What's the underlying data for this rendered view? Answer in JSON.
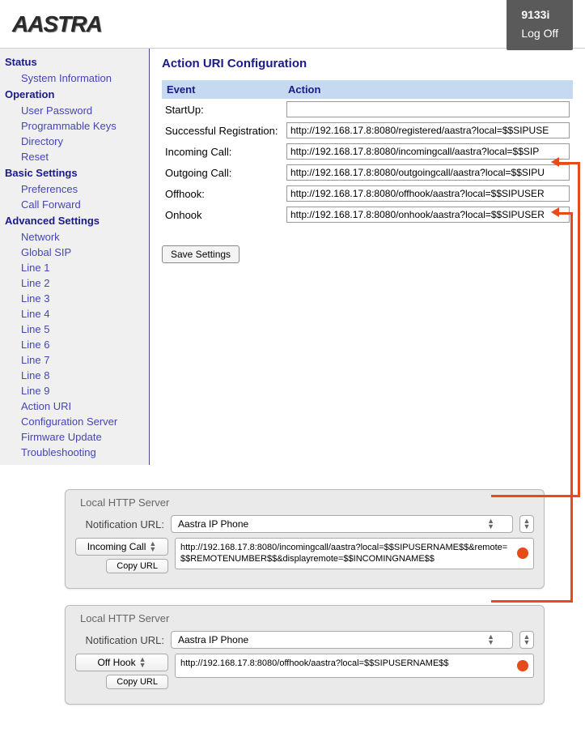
{
  "header": {
    "brand": "AASTRA",
    "model": "9133i",
    "logoff": "Log Off"
  },
  "sidebar": [
    {
      "type": "heading",
      "label": "Status"
    },
    {
      "type": "item",
      "label": "System Information"
    },
    {
      "type": "heading",
      "label": "Operation"
    },
    {
      "type": "item",
      "label": "User Password"
    },
    {
      "type": "item",
      "label": "Programmable Keys"
    },
    {
      "type": "item",
      "label": "Directory"
    },
    {
      "type": "item",
      "label": "Reset"
    },
    {
      "type": "heading",
      "label": "Basic Settings"
    },
    {
      "type": "item",
      "label": "Preferences"
    },
    {
      "type": "item",
      "label": "Call Forward"
    },
    {
      "type": "heading",
      "label": "Advanced Settings"
    },
    {
      "type": "item",
      "label": "Network"
    },
    {
      "type": "item",
      "label": "Global SIP"
    },
    {
      "type": "item",
      "label": "Line 1"
    },
    {
      "type": "item",
      "label": "Line 2"
    },
    {
      "type": "item",
      "label": "Line 3"
    },
    {
      "type": "item",
      "label": "Line 4"
    },
    {
      "type": "item",
      "label": "Line 5"
    },
    {
      "type": "item",
      "label": "Line 6"
    },
    {
      "type": "item",
      "label": "Line 7"
    },
    {
      "type": "item",
      "label": "Line 8"
    },
    {
      "type": "item",
      "label": "Line 9"
    },
    {
      "type": "item",
      "label": "Action URI"
    },
    {
      "type": "item",
      "label": "Configuration Server"
    },
    {
      "type": "item",
      "label": "Firmware Update"
    },
    {
      "type": "item",
      "label": "Troubleshooting"
    }
  ],
  "page": {
    "title": "Action URI Configuration",
    "col_event": "Event",
    "col_action": "Action",
    "rows": [
      {
        "label": "StartUp:",
        "value": ""
      },
      {
        "label": "Successful Registration:",
        "value": "http://192.168.17.8:8080/registered/aastra?local=$$SIPUSE"
      },
      {
        "label": "Incoming Call:",
        "value": "http://192.168.17.8:8080/incomingcall/aastra?local=$$SIP"
      },
      {
        "label": "Outgoing Call:",
        "value": "http://192.168.17.8:8080/outgoingcall/aastra?local=$$SIPU"
      },
      {
        "label": "Offhook:",
        "value": "http://192.168.17.8:8080/offhook/aastra?local=$$SIPUSER"
      },
      {
        "label": "Onhook",
        "value": "http://192.168.17.8:8080/onhook/aastra?local=$$SIPUSER"
      }
    ],
    "save": "Save Settings"
  },
  "panel1": {
    "title": "Local HTTP Server",
    "notif_label": "Notification URL:",
    "select": "Aastra IP Phone",
    "left_btn": "Incoming Call",
    "url": "http://192.168.17.8:8080/incomingcall/aastra?local=$$SIPUSERNAME$$&remote=$$REMOTENUMBER$$&displayremote=$$INCOMINGNAME$$",
    "copy": "Copy URL"
  },
  "panel2": {
    "title": "Local HTTP Server",
    "notif_label": "Notification URL:",
    "select": "Aastra IP Phone",
    "left_btn": "Off Hook",
    "url": "http://192.168.17.8:8080/offhook/aastra?local=$$SIPUSERNAME$$",
    "copy": "Copy URL"
  }
}
